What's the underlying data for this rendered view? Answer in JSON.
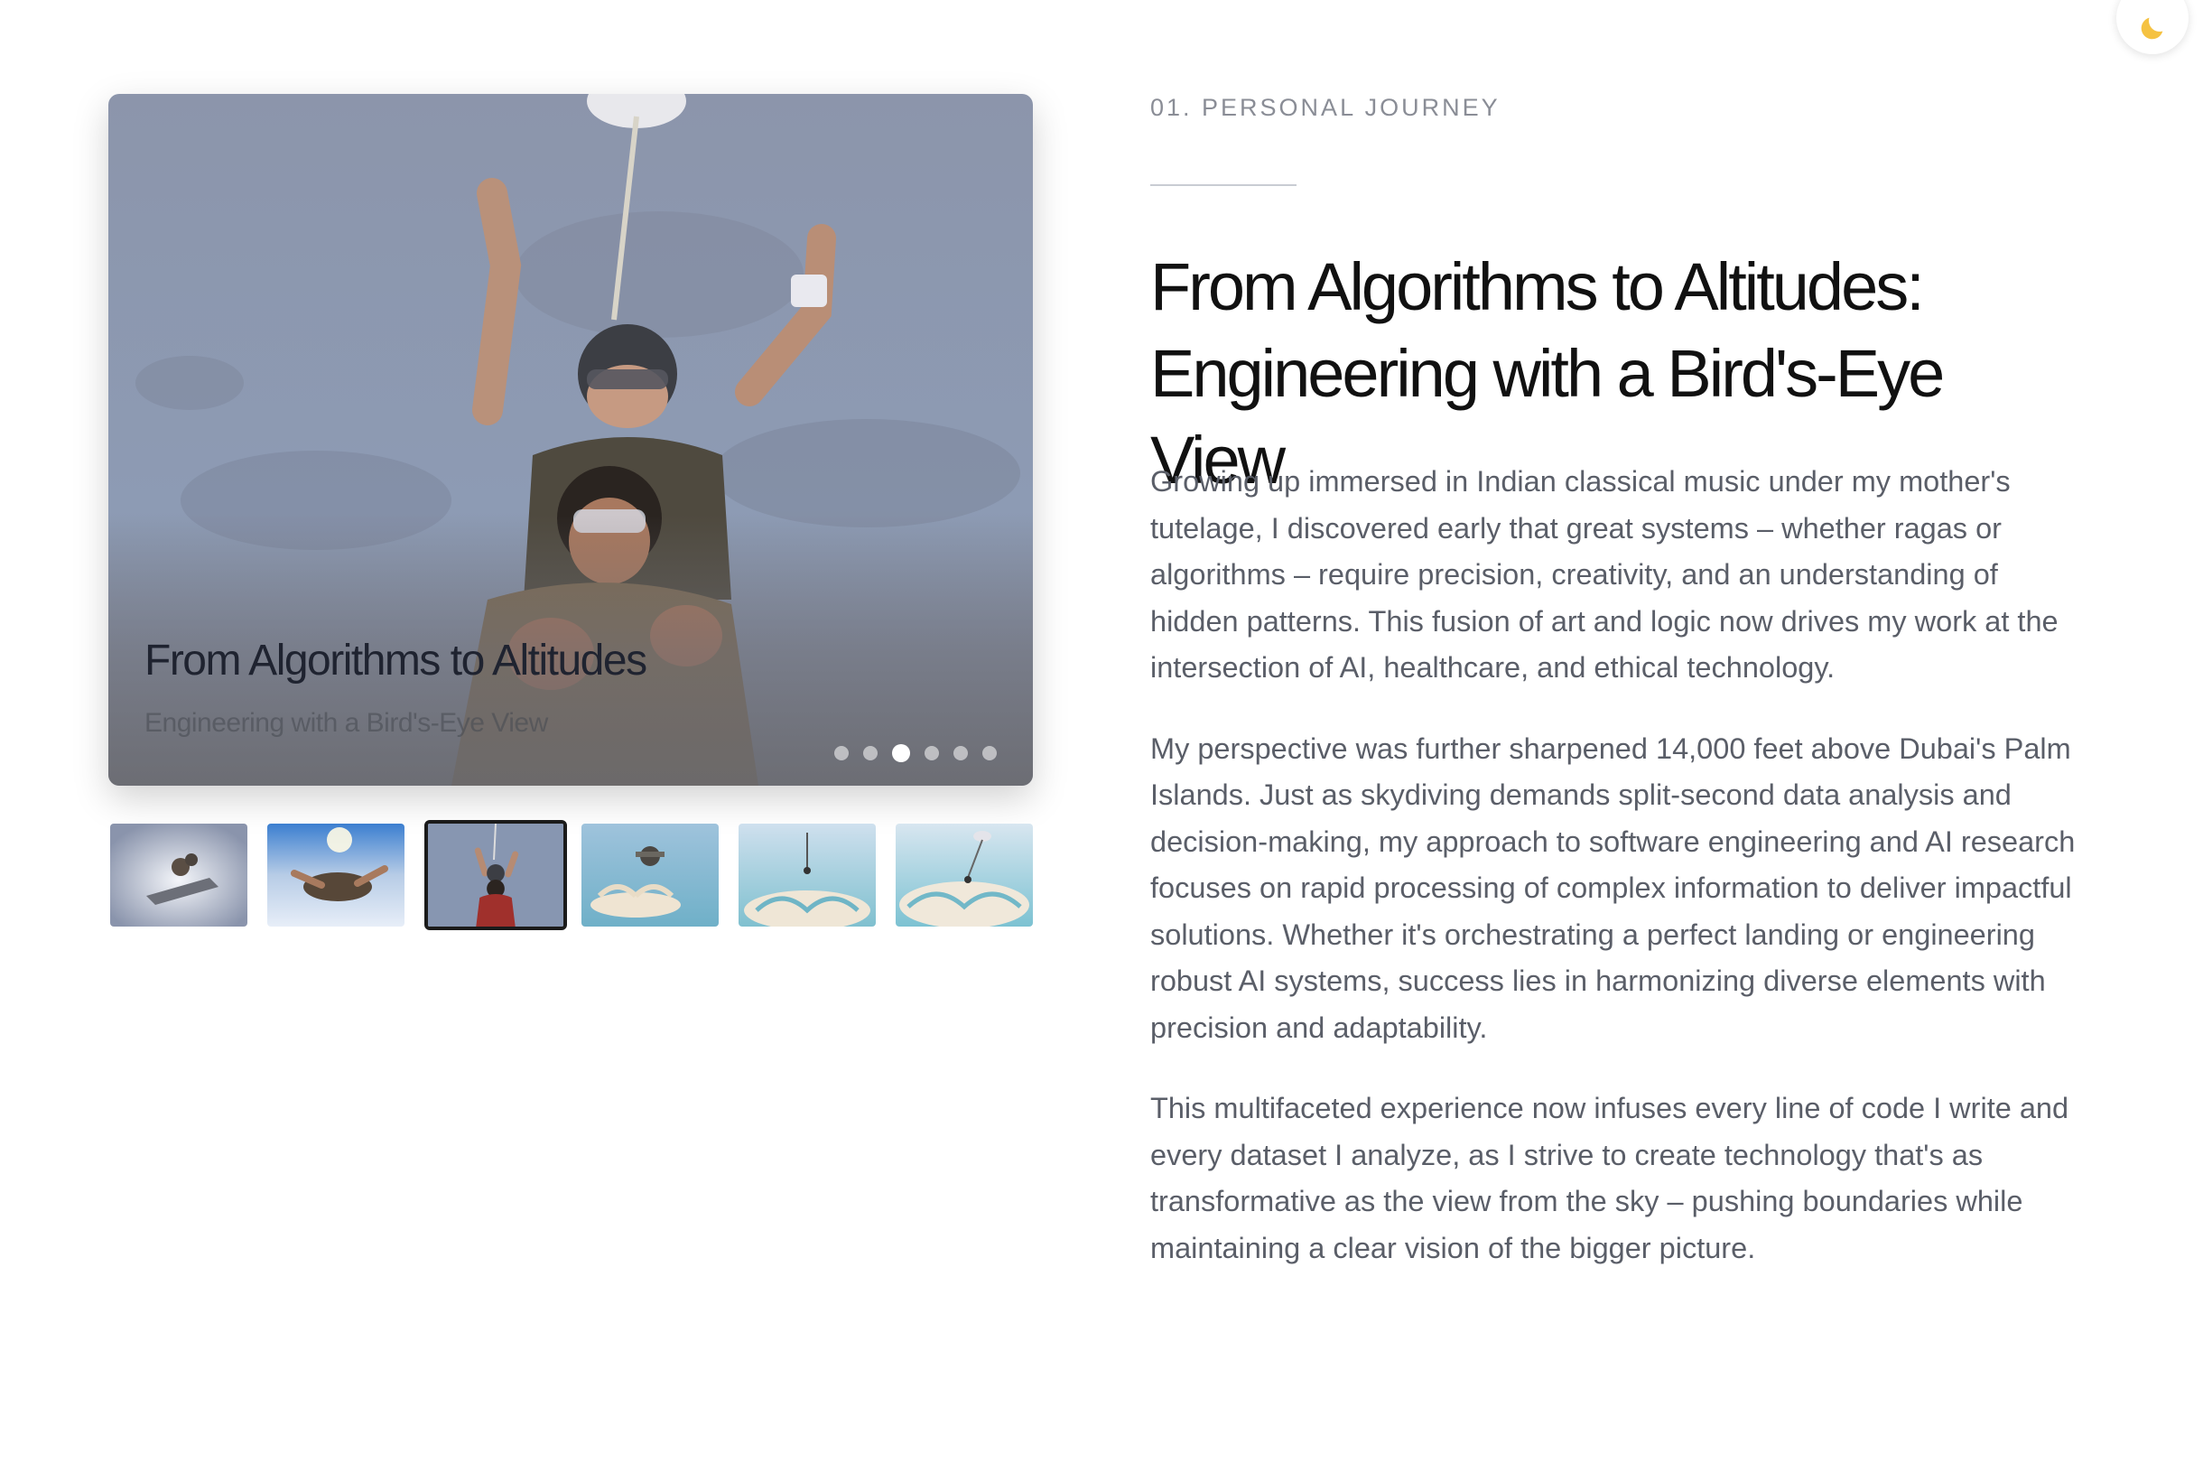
{
  "theme_toggle": {
    "icon": "moon-icon",
    "color": "#f5c242"
  },
  "gallery": {
    "active_index": 2,
    "slide_count": 6,
    "caption_title": "From Algorithms to Altitudes",
    "caption_subtitle": "Engineering with a Bird's-Eye View",
    "thumbnails": [
      {
        "alt": "Skydivers below airplane"
      },
      {
        "alt": "Tandem skydive freefall"
      },
      {
        "alt": "Tandem skydive arms raised"
      },
      {
        "alt": "Parachute over Palm Jumeirah"
      },
      {
        "alt": "Descending toward Palm Islands"
      },
      {
        "alt": "Landing approach over the Palm"
      }
    ]
  },
  "section": {
    "eyebrow": "01. PERSONAL JOURNEY",
    "headline_line1": "From Algorithms to Altitudes:",
    "headline_line2": "Engineering with a Bird's-Eye View",
    "paragraphs": [
      "Growing up immersed in Indian classical music under my mother's tutelage, I discovered early that great systems – whether ragas or algorithms – require precision, creativity, and an understanding of hidden patterns. This fusion of art and logic now drives my work at the intersection of AI, healthcare, and ethical technology.",
      "My perspective was further sharpened 14,000 feet above Dubai's Palm Islands. Just as skydiving demands split-second data analysis and decision-making, my approach to software engineering and AI research focuses on rapid processing of complex information to deliver impactful solutions. Whether it's orchestrating a perfect landing or engineering robust AI systems, success lies in harmonizing diverse elements with precision and adaptability.",
      "This multifaceted experience now infuses every line of code I write and every dataset I analyze, as I strive to create technology that's as transformative as the view from the sky – pushing boundaries while maintaining a clear vision of the bigger picture."
    ]
  }
}
